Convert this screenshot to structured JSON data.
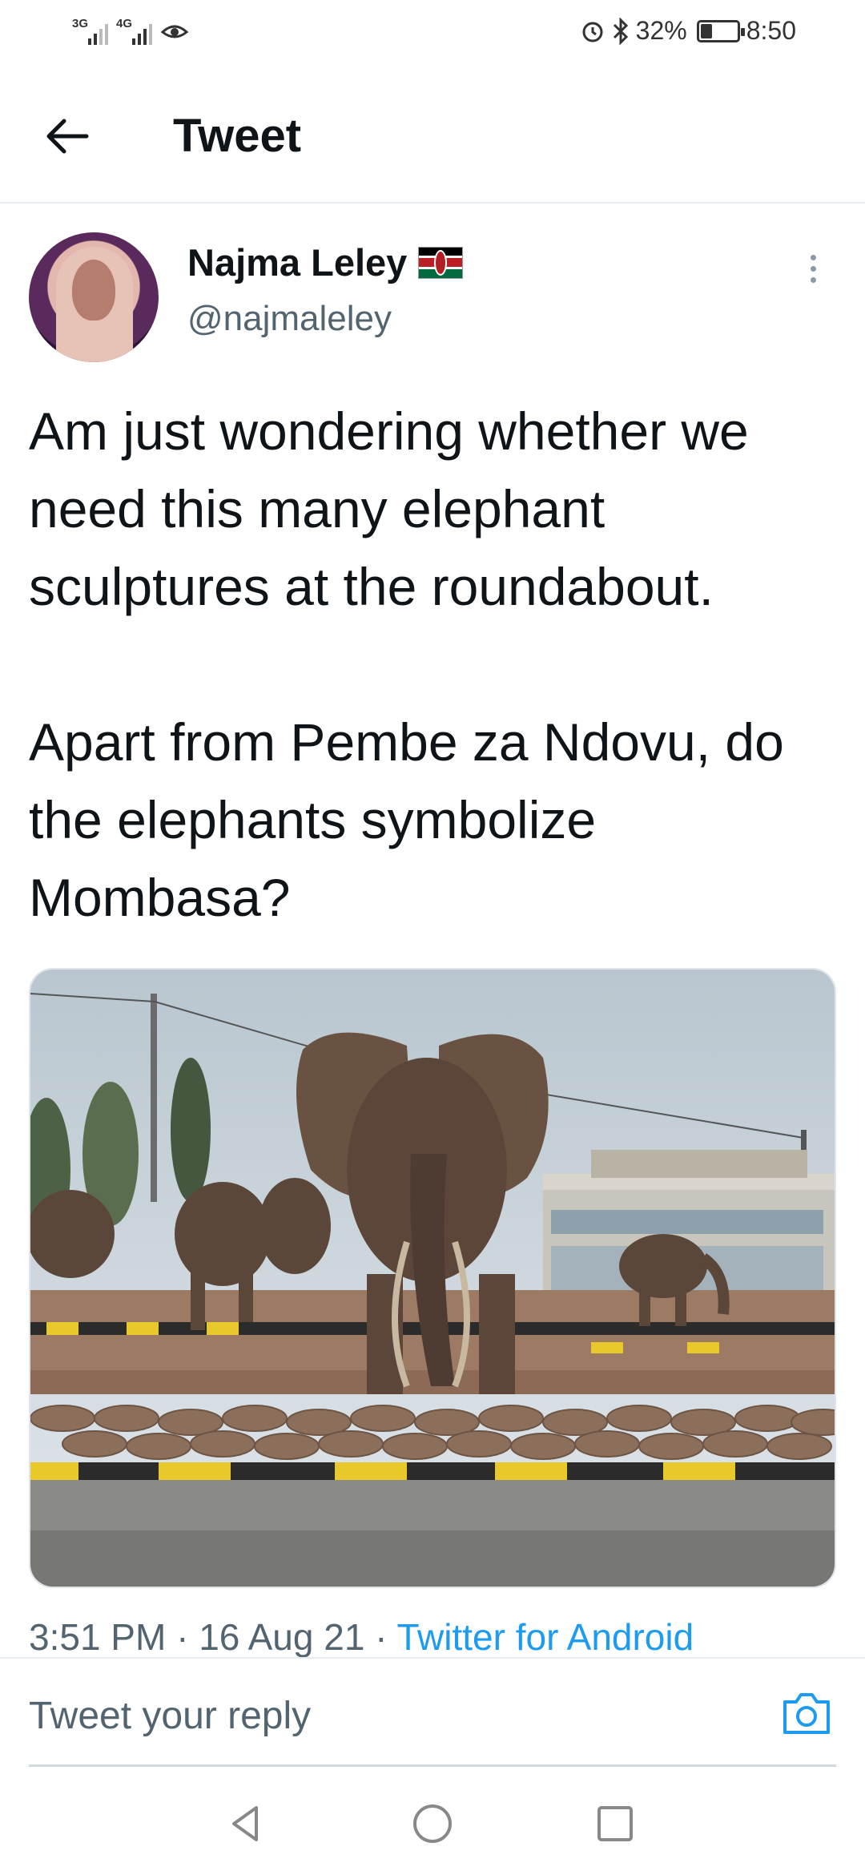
{
  "status_bar": {
    "signal1_label": "3G",
    "signal2_label": "4G",
    "battery_text": "32%",
    "battery_level": 0.32,
    "time": "8:50"
  },
  "header": {
    "title": "Tweet"
  },
  "tweet": {
    "author_name": "Najma Leley",
    "author_handle": "@najmaleley",
    "text": "Am just wondering whether we need this many elephant sculptures at the roundabout.\n\nApart from Pembe za Ndovu, do the elephants symbolize Mombasa?",
    "time": "3:51 PM",
    "date": "16 Aug 21",
    "source": "Twitter for Android",
    "separator": " · "
  },
  "reply": {
    "placeholder": "Tweet your reply"
  },
  "colors": {
    "accent": "#1d9bf0",
    "secondary_text": "#536471"
  }
}
